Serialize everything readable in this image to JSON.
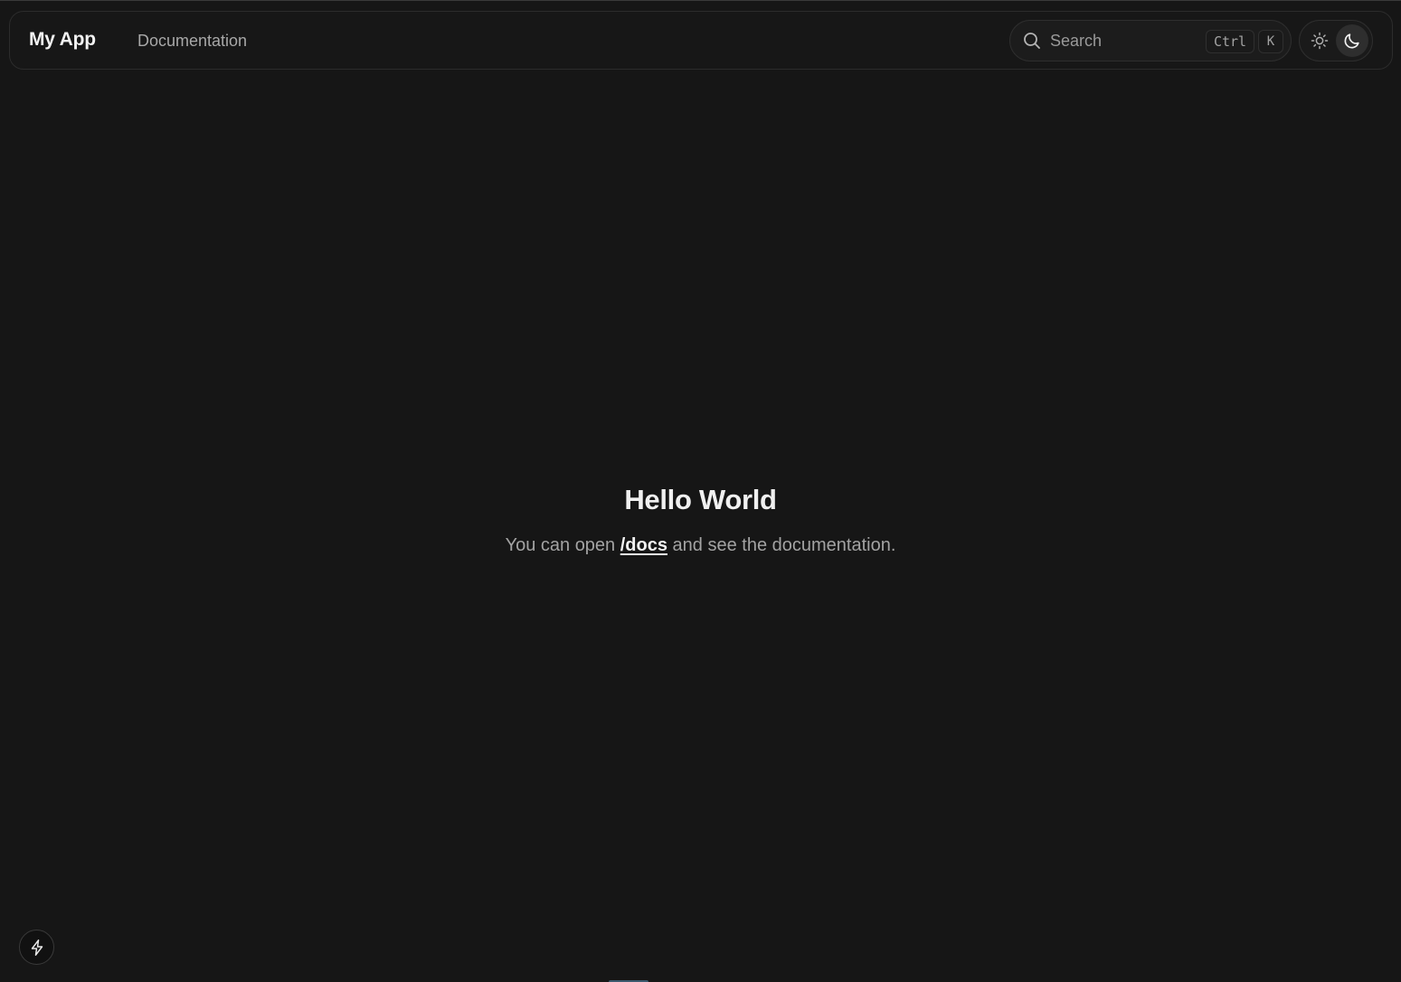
{
  "navbar": {
    "brand": "My App",
    "links": [
      {
        "label": "Documentation"
      }
    ],
    "search": {
      "placeholder": "Search",
      "shortcut_modifier": "Ctrl",
      "shortcut_key": "K",
      "icon": "search-icon"
    },
    "theme_toggle": {
      "options": [
        {
          "name": "light",
          "icon": "sun-icon",
          "selected": false
        },
        {
          "name": "dark",
          "icon": "moon-icon",
          "selected": true
        }
      ]
    }
  },
  "hero": {
    "title": "Hello World",
    "text_before": "You can open ",
    "link_label": "/docs",
    "text_after": " and see the documentation."
  },
  "devtools": {
    "icon": "lightning-bolt-icon"
  },
  "colors": {
    "background": "#161616",
    "text_primary": "#f0f0f0",
    "text_muted": "#a3a3a3"
  }
}
